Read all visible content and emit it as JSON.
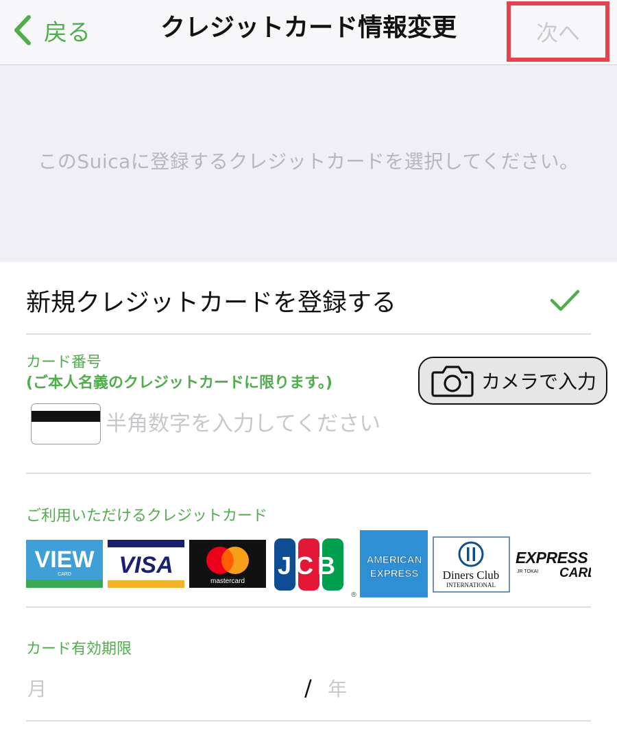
{
  "nav": {
    "back_label": "戻る",
    "title": "クレジットカード情報変更",
    "next_label": "次へ"
  },
  "header": {
    "instruction": "このSuicaに登録するクレジットカードを選択してください。"
  },
  "new_card": {
    "label": "新規クレジットカードを登録する",
    "selected": true
  },
  "card_number": {
    "label": "カード番号",
    "note": "(ご本人名義のクレジットカードに限ります。)",
    "placeholder": "半角数字を入力してください",
    "camera_button_label": "カメラで入力"
  },
  "accepted_cards": {
    "label": "ご利用いただけるクレジットカード",
    "brands": [
      {
        "name": "view-card-logo",
        "text": "VIEW",
        "sub": "CARD"
      },
      {
        "name": "visa-logo",
        "text": "VISA"
      },
      {
        "name": "mastercard-logo",
        "text": "mastercard"
      },
      {
        "name": "jcb-logo",
        "text": "JCB"
      },
      {
        "name": "amex-logo",
        "text": "AMERICAN EXPRESS"
      },
      {
        "name": "diners-club-logo",
        "text": "Diners Club",
        "sub": "INTERNATIONAL"
      },
      {
        "name": "express-card-logo",
        "text": "EXPRESS CARD",
        "sub": "JR TOKAI"
      }
    ]
  },
  "expiry": {
    "label": "カード有効期限",
    "month_placeholder": "月",
    "separator": "/",
    "year_placeholder": "年"
  },
  "colors": {
    "accent_green": "#4fae4b",
    "highlight_red": "#e8434c",
    "header_gray": "#f0eff5",
    "placeholder_gray": "#c8c8cc"
  }
}
